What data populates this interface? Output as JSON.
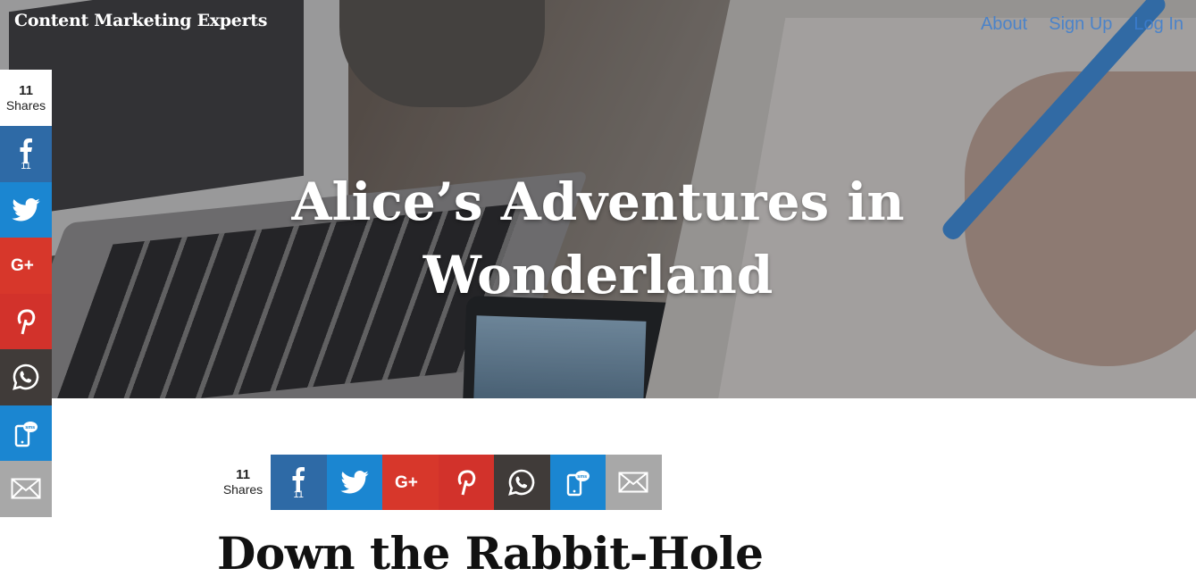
{
  "header": {
    "brand": "Content Marketing Experts",
    "nav": [
      {
        "label": "About"
      },
      {
        "label": "Sign Up"
      },
      {
        "label": "Log In"
      }
    ]
  },
  "hero": {
    "title_line1": "Alice’s Adventures in",
    "title_line2": "Wonderland"
  },
  "share": {
    "count": "11",
    "count_label": "Shares",
    "facebook_count": "11",
    "networks": [
      "facebook-icon",
      "twitter-icon",
      "google-plus-icon",
      "pinterest-icon",
      "whatsapp-icon",
      "sms-icon",
      "email-icon"
    ],
    "colors": {
      "facebook": "#2e6aa6",
      "twitter": "#1b86d1",
      "google_plus": "#d7372b",
      "pinterest": "#d2322b",
      "whatsapp": "#403b39",
      "sms": "#1b86d1",
      "email": "#a8a8a8"
    }
  },
  "article": {
    "heading": "Down the Rabbit-Hole"
  }
}
